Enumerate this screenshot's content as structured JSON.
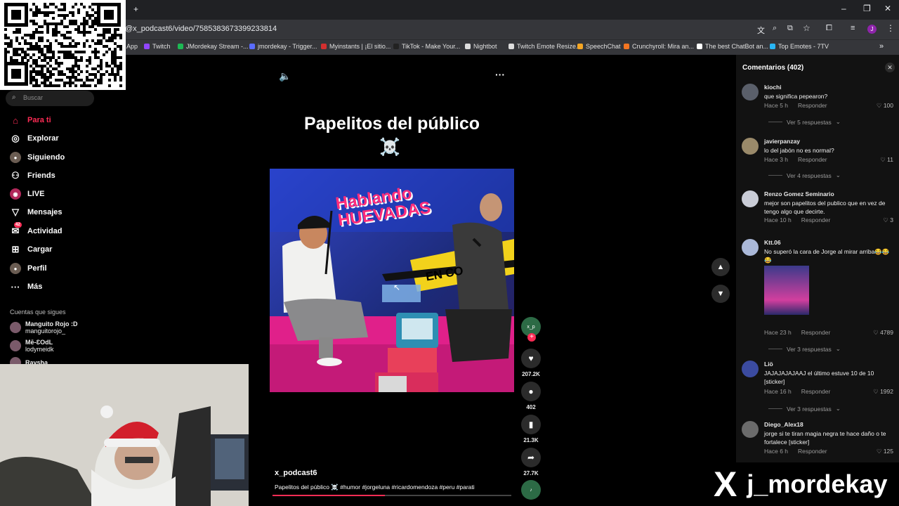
{
  "browser": {
    "new_tab": "+",
    "url": "@x_podcast6/video/7585383673399233814",
    "bookmarks": [
      {
        "label": "App",
        "color": "#4285f4"
      },
      {
        "label": "Twitch",
        "color": "#9146ff"
      },
      {
        "label": "JMordekay Stream -...",
        "color": "#1db954"
      },
      {
        "label": "jmordekay - Trigger...",
        "color": "#5a6cff"
      },
      {
        "label": "Myinstants | ¡El sitio...",
        "color": "#d32f2f"
      },
      {
        "label": "TikTok - Make Your...",
        "color": "#222222"
      },
      {
        "label": "Nightbot",
        "color": "#dddddd"
      },
      {
        "label": "Twitch Emote Resize...",
        "color": "#dddddd"
      },
      {
        "label": "SpeechChat",
        "color": "#f5a623"
      },
      {
        "label": "Crunchyroll: Mira an...",
        "color": "#f47521"
      },
      {
        "label": "The best ChatBot an...",
        "color": "#ffffff"
      },
      {
        "label": "Top Emotes - 7TV",
        "color": "#29b6f6"
      }
    ]
  },
  "sidebar": {
    "search_placeholder": "Buscar",
    "nav": [
      {
        "label": "Para ti",
        "icon": "home-icon",
        "glyph": "⌂"
      },
      {
        "label": "Explorar",
        "icon": "compass-icon",
        "glyph": "◎"
      },
      {
        "label": "Siguiendo",
        "icon": "avatar-icon",
        "glyph": "●"
      },
      {
        "label": "Friends",
        "icon": "friends-icon",
        "glyph": "⚇"
      },
      {
        "label": "LIVE",
        "icon": "live-icon",
        "glyph": "◉"
      },
      {
        "label": "Mensajes",
        "icon": "messages-icon",
        "glyph": "▽"
      },
      {
        "label": "Actividad",
        "icon": "activity-icon",
        "glyph": "✉"
      },
      {
        "label": "Cargar",
        "icon": "upload-icon",
        "glyph": "⊞"
      },
      {
        "label": "Perfil",
        "icon": "profile-icon",
        "glyph": "●"
      },
      {
        "label": "Más",
        "icon": "more-icon",
        "glyph": "···"
      }
    ],
    "activity_badge": "42",
    "following_header": "Cuentas que sigues",
    "following": [
      {
        "name": "Manguito Rojo :D",
        "handle": "manguitorojo_"
      },
      {
        "name": "Mē-ƐOdL",
        "handle": "lodymeidk"
      },
      {
        "name": "Raysha",
        "handle": ""
      }
    ]
  },
  "video": {
    "title": "Papelitos del público",
    "emoji": "☠️",
    "author": "x_podcast6",
    "description": "Papelitos del público ☠️ #humor #jorgeluna #ricardomendoza #peru #parati",
    "show_logo": "Hablando HUEVADAS",
    "badge": "EN CO",
    "progress": 0.47,
    "actions": {
      "likes": "207.2K",
      "comments": "402",
      "saves": "21.3K",
      "shares": "27.7K"
    }
  },
  "comments": {
    "header": "Comentarios (402)",
    "reply_label": "Responder",
    "items": [
      {
        "user": "kiochi",
        "text": "que significa pepearon?",
        "time": "Hace 5 h",
        "likes": "100",
        "replies": "Ver 5 respuestas"
      },
      {
        "user": "javierpanzay",
        "text": "lo del jabón no es normal?",
        "time": "Hace 3 h",
        "likes": "11",
        "replies": "Ver 4 respuestas"
      },
      {
        "user": "Renzo Gomez Seminario",
        "text": "mejor son papelitos del publico que en vez de tengo algo que decirte.",
        "time": "Hace 10 h",
        "likes": "3",
        "replies": ""
      },
      {
        "user": "Ktt.06",
        "text": "No superó la cara de Jorge al mirar arriba😂😂😂",
        "time": "Hace 23 h",
        "likes": "4789",
        "replies": "Ver 3 respuestas"
      },
      {
        "user": "Liö",
        "text": "JAJAJAJAJAAJ el último estuve 10 de 10 [sticker]",
        "time": "Hace 16 h",
        "likes": "1992",
        "replies": "Ver 3 respuestas"
      },
      {
        "user": "Diego_Alex18",
        "text": "jorge si te tiran magia negra te hace daño o te fortalece [sticker]",
        "time": "Hace 6 h",
        "likes": "125",
        "replies": ""
      }
    ]
  },
  "overlay": {
    "brand_x": "X",
    "brand_name": "j_mordekay"
  },
  "colors": {
    "accent": "#fe2c55",
    "comments_bg": "#121212",
    "browser_bar": "#35363a"
  }
}
